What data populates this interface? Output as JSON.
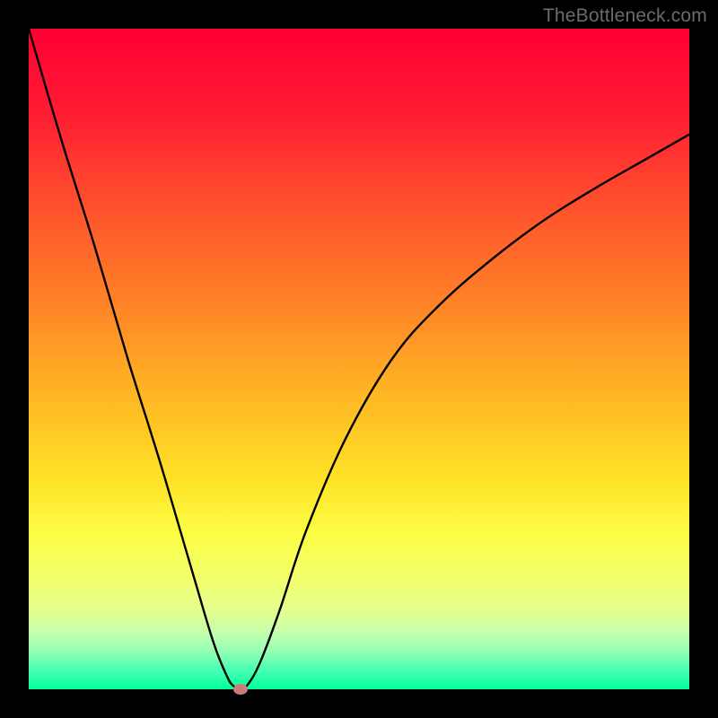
{
  "watermark": "TheBottleneck.com",
  "chart_data": {
    "type": "line",
    "title": "",
    "xlabel": "",
    "ylabel": "",
    "xlim": [
      0,
      100
    ],
    "ylim": [
      0,
      100
    ],
    "background_gradient": {
      "orientation": "vertical",
      "stops": [
        {
          "pos": 0,
          "color": "#ff0033"
        },
        {
          "pos": 30,
          "color": "#ff5c2b"
        },
        {
          "pos": 56,
          "color": "#ffb824"
        },
        {
          "pos": 77,
          "color": "#fcff47"
        },
        {
          "pos": 100,
          "color": "#00ff9c"
        }
      ]
    },
    "series": [
      {
        "name": "bottleneck-curve",
        "x": [
          0,
          5,
          10,
          15,
          20,
          25,
          28,
          30,
          31,
          32,
          33,
          35,
          38,
          42,
          48,
          55,
          62,
          70,
          78,
          86,
          93,
          100
        ],
        "y": [
          100,
          83,
          67,
          50,
          34,
          17,
          7,
          2,
          0.5,
          0,
          0.5,
          4,
          12,
          24,
          38,
          50,
          58,
          65,
          71,
          76,
          80,
          84
        ]
      }
    ],
    "marker": {
      "x": 32,
      "y": 0,
      "color": "#cd7a7a"
    },
    "frame_color": "#000000",
    "curve_color": "#000000"
  }
}
